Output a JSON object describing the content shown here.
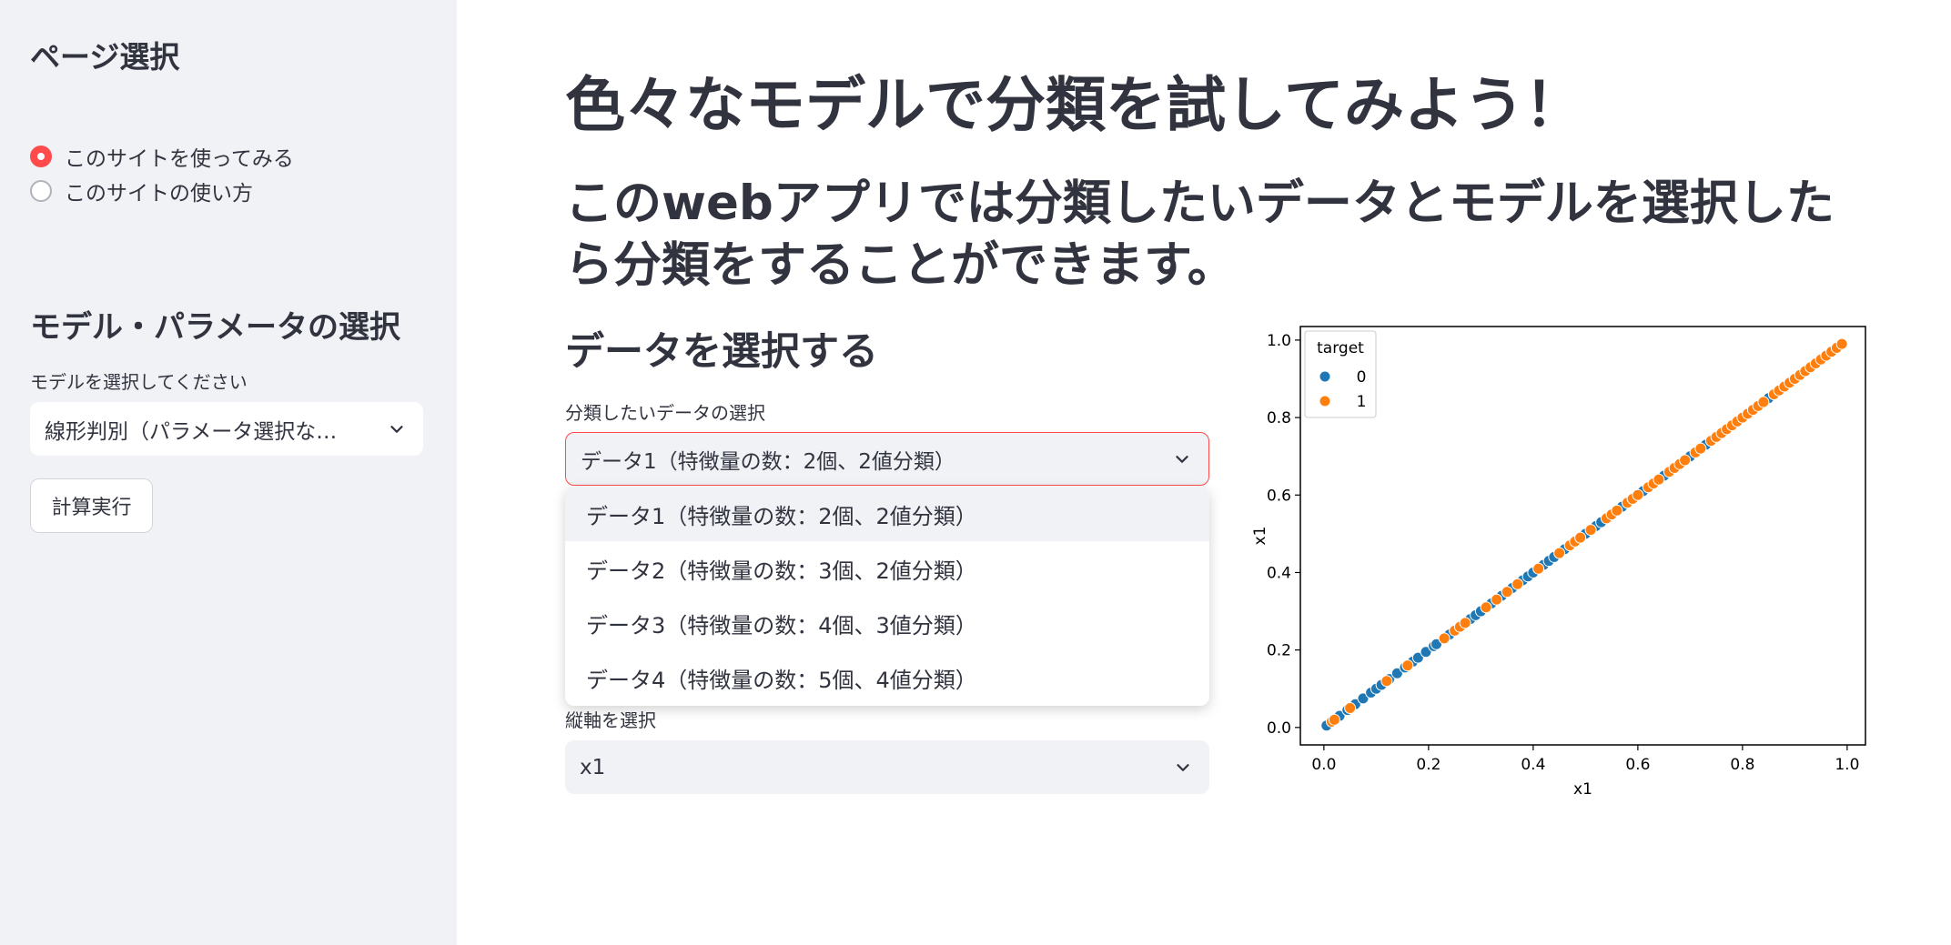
{
  "sidebar": {
    "title": "ページ選択",
    "radio_options": [
      {
        "label": "このサイトを使ってみる",
        "checked": true
      },
      {
        "label": "このサイトの使い方",
        "checked": false
      }
    ],
    "model_section_title": "モデル・パラメータの選択",
    "model_label": "モデルを選択してください",
    "model_value": "線形判別（パラメータ選択な…",
    "run_button": "計算実行"
  },
  "main": {
    "title": "色々なモデルで分類を試してみよう！",
    "subtitle": "このwebアプリでは分類したいデータとモデルを選択したら分類をすることができます。",
    "data_section_title": "データを選択する",
    "data_select_label": "分類したいデータの選択",
    "data_select_value": "データ1（特徴量の数：2個、2値分類）",
    "data_options": [
      "データ1（特徴量の数：2個、2値分類）",
      "データ2（特徴量の数：3個、2値分類）",
      "データ3（特徴量の数：4個、3値分類）",
      "データ4（特徴量の数：5個、4値分類）"
    ],
    "y_axis_label": "縦軸を選択",
    "y_axis_value": "x1"
  },
  "colors": {
    "accent": "#ff4b4b",
    "sidebar_bg": "#f0f2f6",
    "class0": "#1f77b4",
    "class1": "#ff7f0e"
  },
  "chart_data": {
    "type": "scatter",
    "xlabel": "x1",
    "ylabel": "x1",
    "xlim": [
      -0.045,
      1.035
    ],
    "ylim": [
      -0.045,
      1.035
    ],
    "xticks": [
      "0.0",
      "0.2",
      "0.4",
      "0.6",
      "0.8",
      "1.0"
    ],
    "yticks": [
      "0.0",
      "0.2",
      "0.4",
      "0.6",
      "0.8",
      "1.0"
    ],
    "legend": {
      "title": "target",
      "position": "top-left",
      "entries": [
        "0",
        "1"
      ]
    },
    "series": [
      {
        "name": "0",
        "color": "#1f77b4",
        "x": [
          0.005,
          0.03,
          0.045,
          0.06,
          0.075,
          0.09,
          0.1,
          0.11,
          0.125,
          0.14,
          0.155,
          0.17,
          0.18,
          0.195,
          0.21,
          0.215,
          0.24,
          0.28,
          0.29,
          0.3,
          0.32,
          0.34,
          0.36,
          0.38,
          0.39,
          0.4,
          0.42,
          0.43,
          0.44,
          0.46,
          0.5,
          0.52,
          0.53,
          0.57,
          0.61,
          0.65,
          0.7,
          0.73,
          0.85
        ],
        "y": [
          0.005,
          0.03,
          0.045,
          0.06,
          0.075,
          0.09,
          0.1,
          0.11,
          0.125,
          0.14,
          0.155,
          0.17,
          0.18,
          0.195,
          0.21,
          0.215,
          0.24,
          0.28,
          0.29,
          0.3,
          0.32,
          0.34,
          0.36,
          0.38,
          0.39,
          0.4,
          0.42,
          0.43,
          0.44,
          0.46,
          0.5,
          0.52,
          0.53,
          0.57,
          0.61,
          0.65,
          0.7,
          0.73,
          0.85
        ]
      },
      {
        "name": "1",
        "color": "#ff7f0e",
        "x": [
          0.015,
          0.02,
          0.05,
          0.12,
          0.16,
          0.23,
          0.25,
          0.26,
          0.27,
          0.31,
          0.33,
          0.35,
          0.37,
          0.41,
          0.45,
          0.47,
          0.48,
          0.49,
          0.51,
          0.54,
          0.55,
          0.56,
          0.58,
          0.59,
          0.6,
          0.62,
          0.63,
          0.64,
          0.66,
          0.67,
          0.68,
          0.69,
          0.71,
          0.72,
          0.74,
          0.75,
          0.76,
          0.77,
          0.78,
          0.79,
          0.8,
          0.81,
          0.82,
          0.83,
          0.84,
          0.86,
          0.87,
          0.88,
          0.89,
          0.9,
          0.91,
          0.92,
          0.93,
          0.94,
          0.95,
          0.96,
          0.97,
          0.98,
          0.99
        ],
        "y": [
          0.015,
          0.02,
          0.05,
          0.12,
          0.16,
          0.23,
          0.25,
          0.26,
          0.27,
          0.31,
          0.33,
          0.35,
          0.37,
          0.41,
          0.45,
          0.47,
          0.48,
          0.49,
          0.51,
          0.54,
          0.55,
          0.56,
          0.58,
          0.59,
          0.6,
          0.62,
          0.63,
          0.64,
          0.66,
          0.67,
          0.68,
          0.69,
          0.71,
          0.72,
          0.74,
          0.75,
          0.76,
          0.77,
          0.78,
          0.79,
          0.8,
          0.81,
          0.82,
          0.83,
          0.84,
          0.86,
          0.87,
          0.88,
          0.89,
          0.9,
          0.91,
          0.92,
          0.93,
          0.94,
          0.95,
          0.96,
          0.97,
          0.98,
          0.99
        ]
      }
    ]
  }
}
